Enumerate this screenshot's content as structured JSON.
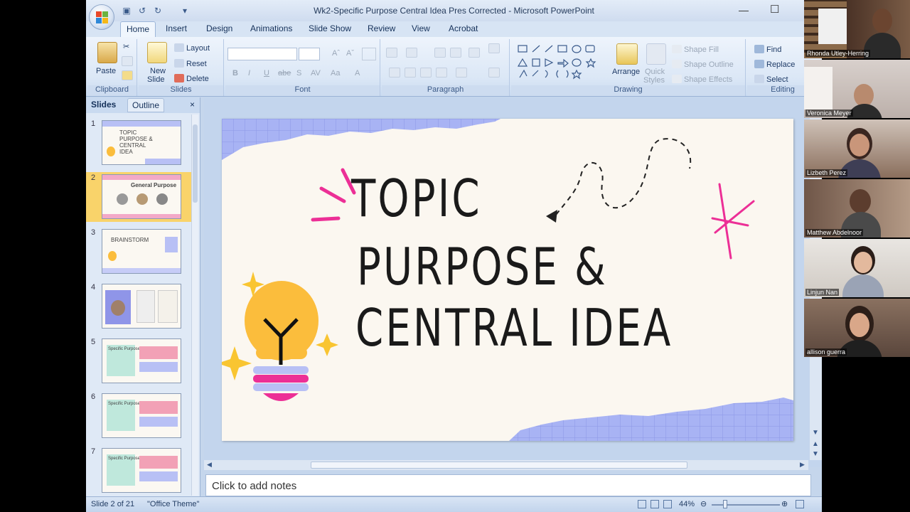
{
  "window": {
    "title": "Wk2-Specific Purpose Central Idea Pres Corrected - Microsoft PowerPoint"
  },
  "tabs": [
    "Home",
    "Insert",
    "Design",
    "Animations",
    "Slide Show",
    "Review",
    "View",
    "Acrobat"
  ],
  "ribbon": {
    "clipboard": {
      "paste": "Paste",
      "label": "Clipboard"
    },
    "slides": {
      "new_slide_line1": "New",
      "new_slide_line2": "Slide",
      "layout": "Layout",
      "reset": "Reset",
      "delete": "Delete",
      "label": "Slides"
    },
    "font": {
      "bold": "B",
      "italic": "I",
      "underline": "U",
      "strike": "abe",
      "shadow": "S",
      "aa": "Aa",
      "label": "Font"
    },
    "paragraph": {
      "label": "Paragraph"
    },
    "drawing": {
      "arrange": "Arrange",
      "quick_line1": "Quick",
      "quick_line2": "Styles",
      "shape_fill": "Shape Fill",
      "shape_outline": "Shape Outline",
      "shape_effects": "Shape Effects",
      "label": "Drawing"
    },
    "editing": {
      "find": "Find",
      "replace": "Replace",
      "select": "Select",
      "label": "Editing"
    }
  },
  "pane": {
    "tab_slides": "Slides",
    "tab_outline": "Outline",
    "thumbs": [
      {
        "num": "1",
        "text": "TOPIC PURPOSE & CENTRAL IDEA"
      },
      {
        "num": "2",
        "text": "General Purpose"
      },
      {
        "num": "3",
        "text": "BRAINSTORM"
      },
      {
        "num": "4",
        "text": ""
      },
      {
        "num": "5",
        "text": "Specific Purpose"
      },
      {
        "num": "6",
        "text": "Specific Purpose"
      },
      {
        "num": "7",
        "text": "Specific Purpose"
      }
    ]
  },
  "slide": {
    "line1": "TOPIC",
    "line2": "PURPOSE &",
    "line3": "CENTRAL IDEA"
  },
  "notes": {
    "placeholder": "Click to add notes"
  },
  "status": {
    "slide_count": "Slide 2 of 21",
    "theme": "\"Office Theme\"",
    "zoom": "44%"
  },
  "participants": [
    {
      "name": "Rhonda Utley-Herring"
    },
    {
      "name": "Veronica Meyer"
    },
    {
      "name": "Lizbeth Perez"
    },
    {
      "name": "Matthew Abdelnoor"
    },
    {
      "name": "Linjun Nan"
    },
    {
      "name": "allison guerra"
    }
  ],
  "colors": {
    "accent_pink": "#ec2f96",
    "bulb_yellow": "#fbbd3c",
    "grid_purple": "#a8b3f4",
    "selected_thumb": "#f9d36a"
  }
}
